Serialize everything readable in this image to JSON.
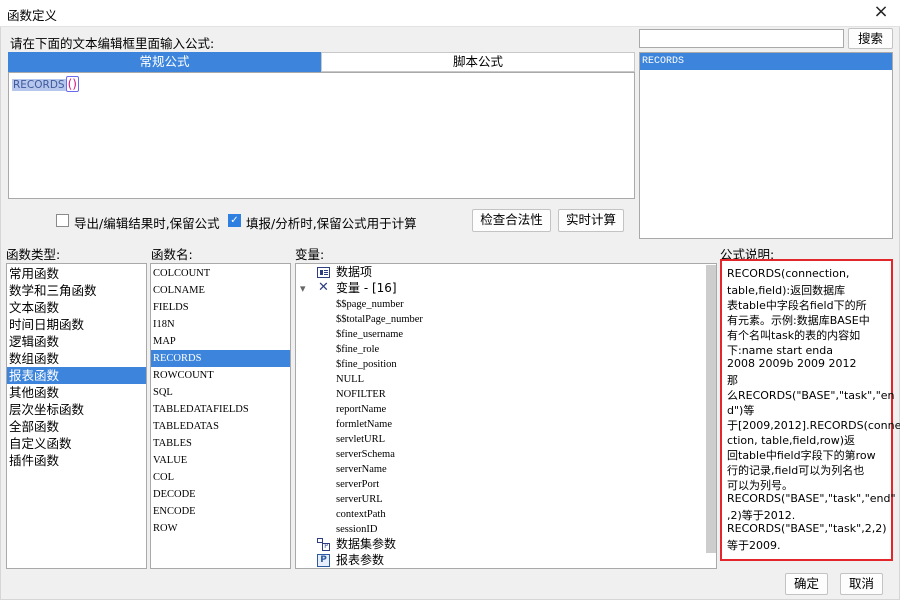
{
  "window": {
    "title": "函数定义",
    "close_icon": "×"
  },
  "header": {
    "prompt": "请在下面的文本编辑框里面输入公式:",
    "search_placeholder": "",
    "search_value": "",
    "search_button": "搜索"
  },
  "tabs": [
    {
      "label": "常规公式",
      "active": true
    },
    {
      "label": "脚本公式",
      "active": false
    }
  ],
  "editor": {
    "formula_name": "RECORDS",
    "formula_open": "(",
    "formula_close": ")"
  },
  "search_results": {
    "items": [
      "RECORDS"
    ]
  },
  "options": {
    "export_keep": {
      "label": "导出/编辑结果时,保留公式",
      "checked": false
    },
    "fill_keep": {
      "label": "填报/分析时,保留公式用于计算",
      "checked": true
    },
    "check_button": "检查合法性",
    "realtime_button": "实时计算"
  },
  "labels": {
    "func_type": "函数类型:",
    "func_name": "函数名:",
    "variable": "变量:",
    "description": "公式说明:"
  },
  "function_types": {
    "items": [
      "常用函数",
      "数学和三角函数",
      "文本函数",
      "时间日期函数",
      "逻辑函数",
      "数组函数",
      "报表函数",
      "其他函数",
      "层次坐标函数",
      "全部函数",
      "自定义函数",
      "插件函数"
    ],
    "selected": 6
  },
  "function_names": {
    "items": [
      "COLCOUNT",
      "COLNAME",
      "FIELDS",
      "I18N",
      "MAP",
      "RECORDS",
      "ROWCOUNT",
      "SQL",
      "TABLEDATAFIELDS",
      "TABLEDATAS",
      "TABLES",
      "VALUE",
      "COL",
      "DECODE",
      "ENCODE",
      "ROW"
    ],
    "selected": 5
  },
  "variables": {
    "data_item": "数据项",
    "var_group": "变量 - [16]",
    "expand_icon": "▾",
    "items": [
      "$$page_number",
      "$$totalPage_number",
      "$fine_username",
      "$fine_role",
      "$fine_position",
      "NULL",
      "NOFILTER",
      "reportName",
      "formletName",
      "servletURL",
      "serverSchema",
      "serverName",
      "serverPort",
      "serverURL",
      "contextPath",
      "sessionID"
    ],
    "dataset_params": "数据集参数",
    "report_params": "报表参数",
    "report_params_icon": "P"
  },
  "description": {
    "lines": [
      "RECORDS(connection,",
      "table,field):返回数据库",
      "表table中字段名field下的所",
      "有元素。示例:数据库BASE中",
      "有个名叫task的表的内容如",
      "下:name start  enda",
      "2008    2009b    2009   2012",
      "那",
      "么RECORDS(\"BASE\",\"task\",\"en",
      "d\")等",
      "于[2009,2012].RECORDS(conne",
      "ction, table,field,row)返",
      "回table中field字段下的第row",
      "行的记录,field可以为列名也",
      "可以为列号。",
      "RECORDS(\"BASE\",\"task\",\"end\"",
      ",2)等于2012.",
      "RECORDS(\"BASE\",\"task\",2,2)",
      "等于2009."
    ]
  },
  "footer": {
    "ok": "确定",
    "cancel": "取消"
  }
}
